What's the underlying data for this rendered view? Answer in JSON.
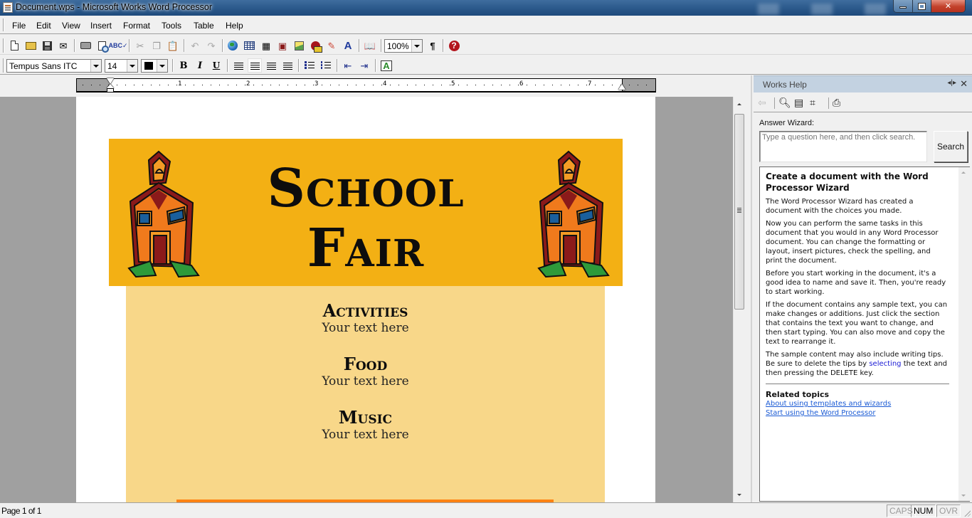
{
  "window": {
    "title": "Document.wps - Microsoft Works Word Processor"
  },
  "menu": [
    "File",
    "Edit",
    "View",
    "Insert",
    "Format",
    "Tools",
    "Table",
    "Help"
  ],
  "toolbar": {
    "zoom_value": "100%",
    "font_name": "Tempus Sans ITC",
    "font_size": "14",
    "font_color": "#000000",
    "bold_label": "B",
    "italic_label": "I",
    "underline_label": "U",
    "paragraph_mark": "¶",
    "help_glyph": "?"
  },
  "ruler": {
    "numbers": [
      "1",
      "2",
      "3",
      "4",
      "5",
      "6",
      "7"
    ]
  },
  "document": {
    "banner_title_line1": "School",
    "banner_title_line2": "Fair",
    "sections": [
      {
        "heading": "Activities",
        "body": "Your text here"
      },
      {
        "heading": "Food",
        "body": "Your text here"
      },
      {
        "heading": "Music",
        "body": "Your text here"
      }
    ],
    "colors": {
      "banner": "#f3b014",
      "content_box": "#f8d789",
      "accent_bar": "#fd8213"
    }
  },
  "help_pane": {
    "title": "Works Help",
    "answer_wizard_label": "Answer Wizard:",
    "search_placeholder": "Type a question here, and then click search.",
    "search_button": "Search",
    "heading": "Create a document with the Word Processor Wizard",
    "paragraphs": [
      "The Word Processor Wizard has created a document with the choices you made.",
      "Now you can perform the same tasks in this document that you would in any Word Processor document. You can change the formatting or layout, insert pictures, check the spelling, and print the document.",
      "Before you start working in the document, it's a good idea to name and save it. Then, you're ready to start working.",
      "If the document contains any sample text, you can make changes or additions. Just click the section that contains the text you want to change, and then start typing. You can also move and copy the text to rearrange it."
    ],
    "tip_before": "The sample content may also include writing tips. Be sure to delete the tips by ",
    "tip_link": "selecting",
    "tip_after": " the text and then pressing the DELETE key.",
    "related_title": "Related topics",
    "related_links": [
      "About using templates and wizards",
      "Start using the Word Processor"
    ]
  },
  "status": {
    "page_info": "Page 1 of 1",
    "caps": "CAPS",
    "num": "NUM",
    "ovr": "OVR"
  }
}
